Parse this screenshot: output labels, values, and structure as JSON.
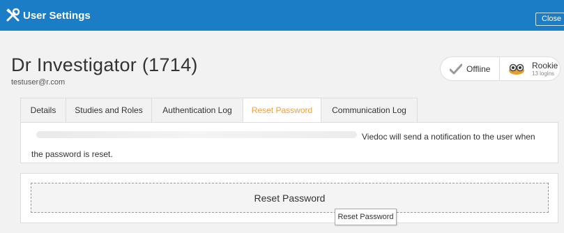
{
  "window": {
    "title": "User Settings",
    "close_label": "Close",
    "accent": "#1a7dc5"
  },
  "user": {
    "name": "Dr Investigator (1714)",
    "email": "testuser@r.com"
  },
  "status": {
    "online_label": "Offline",
    "rank_label": "Rookie",
    "logins_label": "13 logins"
  },
  "tabs": [
    {
      "label": "Details"
    },
    {
      "label": "Studies and Roles"
    },
    {
      "label": "Authentication Log"
    },
    {
      "label": "Reset Password",
      "active": true
    },
    {
      "label": "Communication Log"
    }
  ],
  "info": {
    "line1": "Viedoc will send a notification to the user when",
    "line2": "the password is reset."
  },
  "actions": {
    "reset_label": "Reset Password",
    "tooltip": "Reset Password"
  },
  "colors": {
    "active_tab": "#f0a040",
    "check": "#9a9a9a"
  },
  "icons": {
    "title": "wrench-screwdriver-icon",
    "status": "check-icon",
    "rank": "owl-icon"
  }
}
